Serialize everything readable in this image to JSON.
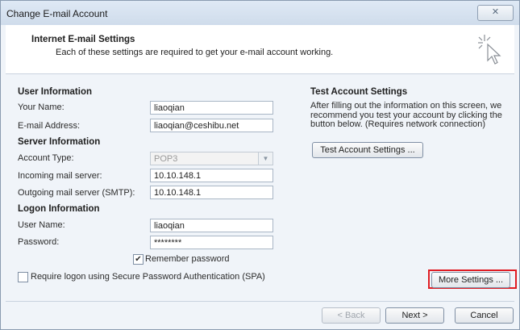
{
  "window": {
    "title": "Change E-mail Account",
    "close_glyph": "✕"
  },
  "header": {
    "title": "Internet E-mail Settings",
    "subtitle": "Each of these settings are required to get your e-mail account working.",
    "icon": "cursor-sparkle-icon"
  },
  "user_info": {
    "heading": "User Information",
    "name_label": "Your Name:",
    "name_value": "liaoqian",
    "email_label": "E-mail Address:",
    "email_value": "liaoqian@ceshibu.net"
  },
  "server_info": {
    "heading": "Server Information",
    "account_type_label": "Account Type:",
    "account_type_value": "POP3",
    "incoming_label": "Incoming mail server:",
    "incoming_value": "10.10.148.1",
    "outgoing_label": "Outgoing mail server (SMTP):",
    "outgoing_value": "10.10.148.1"
  },
  "logon_info": {
    "heading": "Logon Information",
    "username_label": "User Name:",
    "username_value": "liaoqian",
    "password_label": "Password:",
    "password_value": "********",
    "remember_label": "Remember password",
    "remember_checked": true,
    "spa_label": "Require logon using Secure Password Authentication (SPA)",
    "spa_checked": false
  },
  "test": {
    "heading": "Test Account Settings",
    "description_lines": [
      "After filling out the information on this screen, we",
      "recommend you test your account by clicking the",
      "button below. (Requires network connection)"
    ],
    "button_label": "Test Account Settings ..."
  },
  "more_settings_label": "More Settings ...",
  "nav": {
    "back_label": "< Back",
    "next_label": "Next >",
    "cancel_label": "Cancel"
  },
  "colors": {
    "highlight": "#e01d24",
    "accent": "#3a6ea5"
  }
}
